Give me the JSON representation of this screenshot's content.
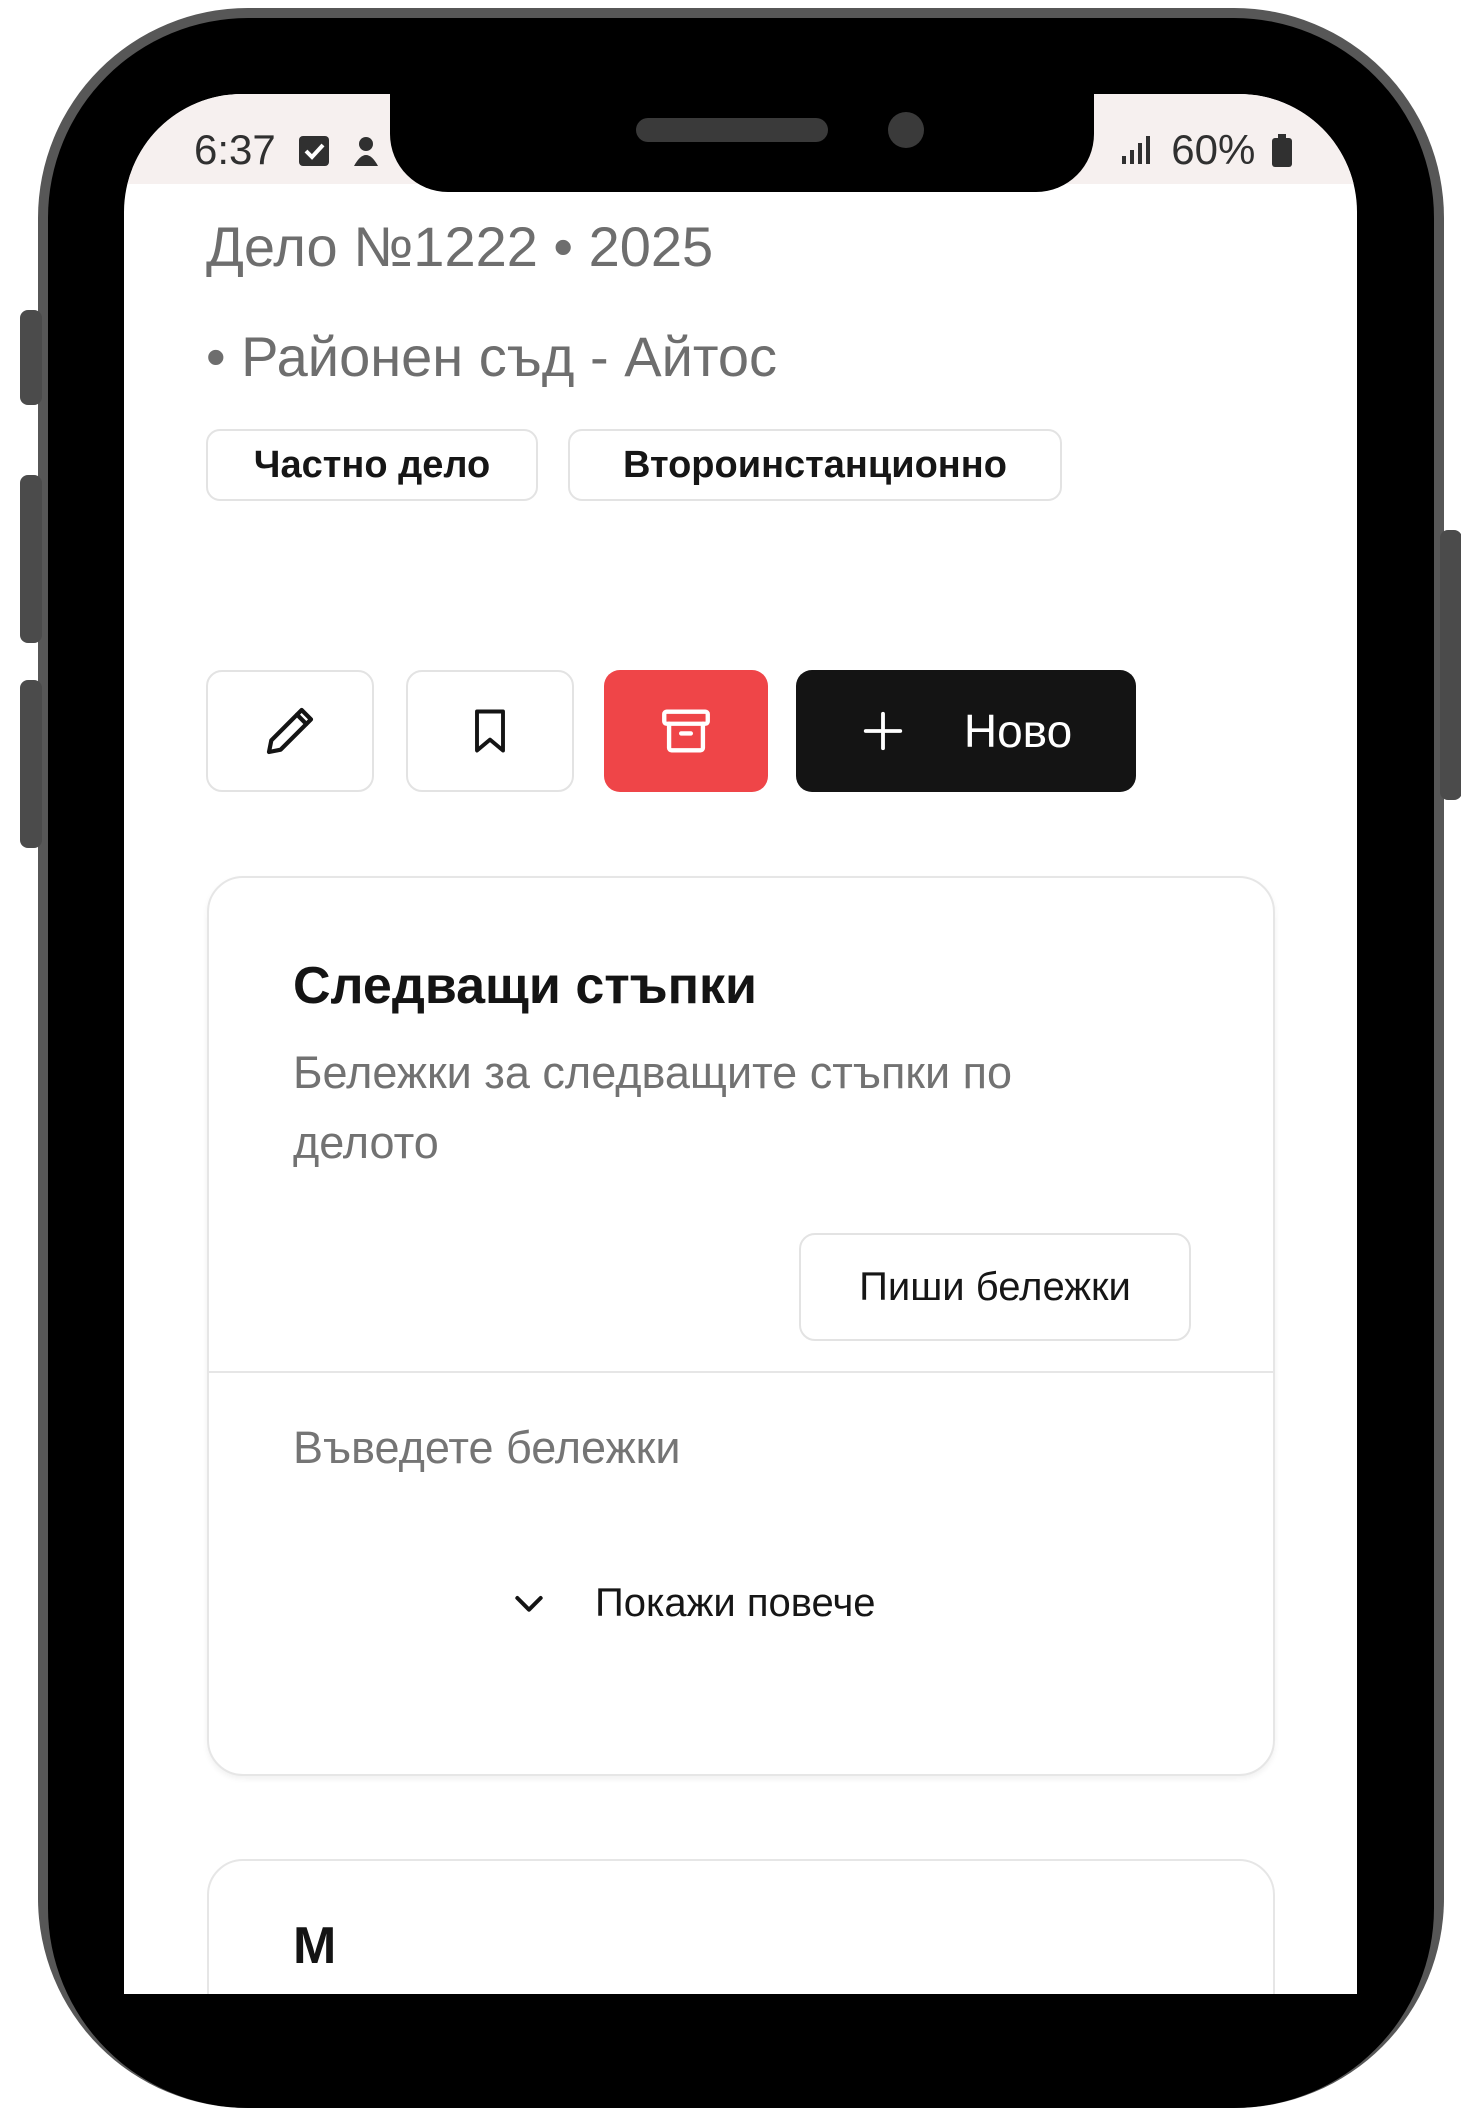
{
  "status_bar": {
    "time": "6:37",
    "battery": "60%",
    "icons": [
      "checkbox-notification-icon",
      "app-notification-icon",
      "signal-icon",
      "battery-icon"
    ]
  },
  "case": {
    "title": "Дело №1222  • 2025",
    "court": "• Районен съд - Айтос",
    "tags": [
      "Частно дело",
      "Второинстанционно"
    ]
  },
  "actions": {
    "edit_icon": "pencil-icon",
    "bookmark_icon": "bookmark-icon",
    "archive_icon": "archive-icon",
    "new_label": "Ново",
    "colors": {
      "archive": "#ef4548",
      "primary": "#141414"
    }
  },
  "next_steps": {
    "title": "Следващи стъпки",
    "subtitle": "Бележки за следващите стъпки по делото",
    "write_button": "Пиши бележки",
    "notes_placeholder": "Въведете бележки",
    "show_more": "Покажи повече"
  },
  "next_card": {
    "title": "М"
  }
}
